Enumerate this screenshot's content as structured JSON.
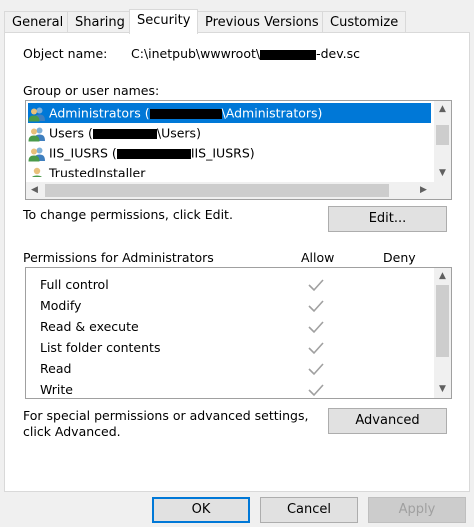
{
  "tabs": [
    {
      "label": "General"
    },
    {
      "label": "Sharing"
    },
    {
      "label": "Security"
    },
    {
      "label": "Previous Versions"
    },
    {
      "label": "Customize"
    }
  ],
  "object": {
    "label": "Object name:",
    "path_prefix": "C:\\inetpub\\wwwroot\\",
    "path_suffix": "-dev.sc"
  },
  "groups": {
    "label": "Group or user names:",
    "items": [
      {
        "prefix": "Administrators (",
        "suffix": "\\Administrators)"
      },
      {
        "prefix": "Users (",
        "suffix": "\\Users)"
      },
      {
        "prefix": "IIS_IUSRS (",
        "suffix": "IIS_IUSRS)"
      },
      {
        "prefix": "TrustedInstaller",
        "suffix": ""
      }
    ]
  },
  "change_text": "To change permissions, click Edit.",
  "edit_button": "Edit...",
  "permissions": {
    "header": "Permissions for Administrators",
    "allow": "Allow",
    "deny": "Deny",
    "items": [
      {
        "name": "Full control"
      },
      {
        "name": "Modify"
      },
      {
        "name": "Read & execute"
      },
      {
        "name": "List folder contents"
      },
      {
        "name": "Read"
      },
      {
        "name": "Write"
      }
    ]
  },
  "advanced": {
    "text_line1": "For special permissions or advanced settings,",
    "text_line2": "click Advanced.",
    "button": "Advanced"
  },
  "footer": {
    "ok": "OK",
    "cancel": "Cancel",
    "apply": "Apply"
  },
  "colors": {
    "selection": "#0078d7",
    "check": "#a0a0a0"
  }
}
